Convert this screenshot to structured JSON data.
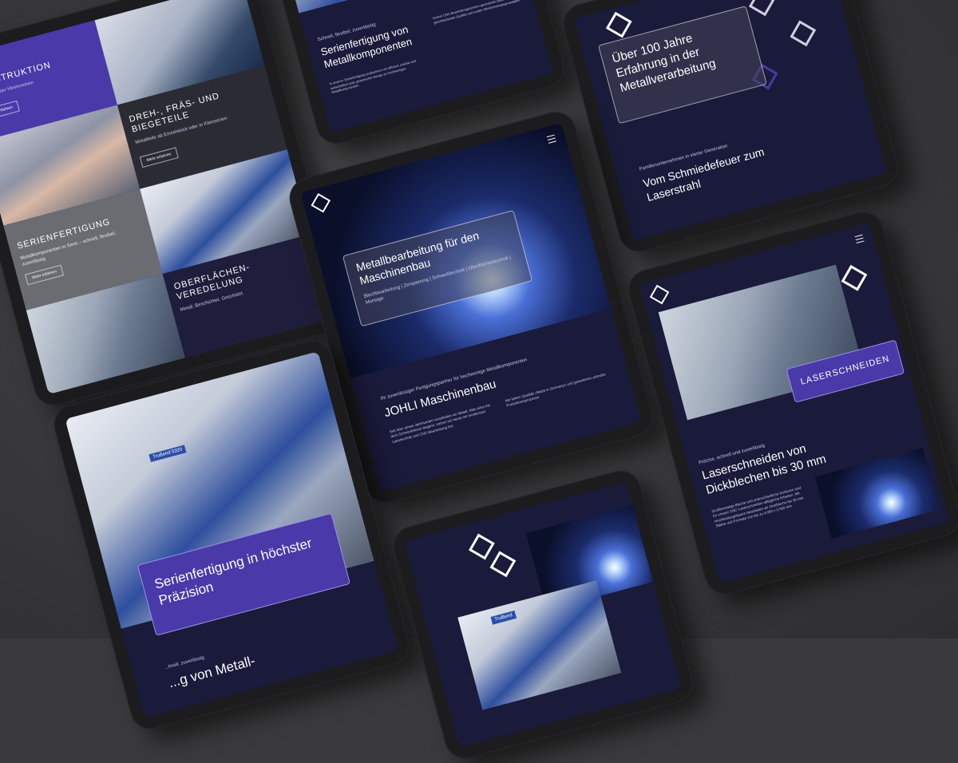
{
  "t1": {
    "konstruktion": "KONSTRUKTION",
    "konstruktion_sub": "Komplett über Hineinreinen",
    "more1": "Mehr erfahren",
    "dreh": "DREH-, FRÄS- UND BIEGETEILE",
    "dreh_sub": "Metallteile ab Einzelstück oder in Kleinserien",
    "more2": "Mehr erfahren",
    "serien": "SERIENFERTIGUNG",
    "serien_sub": "Metallkomponenten in Serie – schnell, flexibel, zuverlässig",
    "more3": "Mehr erfahren",
    "ober": "OBERFLÄCHEN-VEREDELUNG",
    "ober_sub": "Metall. Beschichtet. Geschützt."
  },
  "t2": {
    "kicker": "Schnell, flexibel, zuverlässig",
    "title": "Serienfertigung von Metallkomponenten",
    "p1": "In unserer Serienfertigung produzieren wir effizient, präzise und wirtschaftlich jede gewünschte Menge an hochwertigen Metallkomponenten.",
    "p2": "Unsere CNC-Bearbeitungszentren garantieren dabei stets gleichbleibende Qualität und exakte Wiederholungsgenauigkeit."
  },
  "t3": {
    "headline": "Über 100 Jahre Erfahrung in der Metallverarbeitung",
    "kicker": "Familienunternehmen in vierter Generation",
    "title": "Vom Schmiedefeuer zum Laserstrahl"
  },
  "t4": {
    "hero_title": "Metallbearbeitung für den Maschinenbau",
    "hero_sub": "Blechbearbeitung | Zerspanung | Schweißtechnik | Oberflächentechnik | Montage",
    "kicker": "Ihr zuverlässiger Fertigungspartner für hochwertige Metallkomponenten",
    "title": "JOHLI Maschinenbau",
    "p1": "Seit über einem Jahrhundert verarbeiten wir Metall. Was einst mit dem Schmiedefeuer begann, setzen wir heute mit modernster Lasertechnik und CNC-Bearbeitung fort.",
    "p2": "Wir liefern Qualität »Made in Germany« und garantieren zeitnahe Produktionsprozesse."
  },
  "t5": {
    "badge": "LASERSCHNEIDEN",
    "kicker": "Präzise, schnell und zuverlässig",
    "title": "Laserschneiden von Dickblechen bis 30 mm",
    "p1": "Großformatige Bleche und unterschiedliche Konturen sind für unsere CNC-Laserschneiden alltägliche Arbeiten. Mit Hochleistungslasern bearbeiten wir Dickbleche bis 30 mm Stärke und Formate von bis zu 4.000 x 2.000 mm."
  },
  "t6": {
    "hero_title": "Serienfertigung in höchster Präzision",
    "machine_label": "TruBend 5320",
    "kicker": "...hnell, zuverlässig",
    "title": "...g von Metall-"
  },
  "t7": {
    "machine_label": "TruBend"
  }
}
